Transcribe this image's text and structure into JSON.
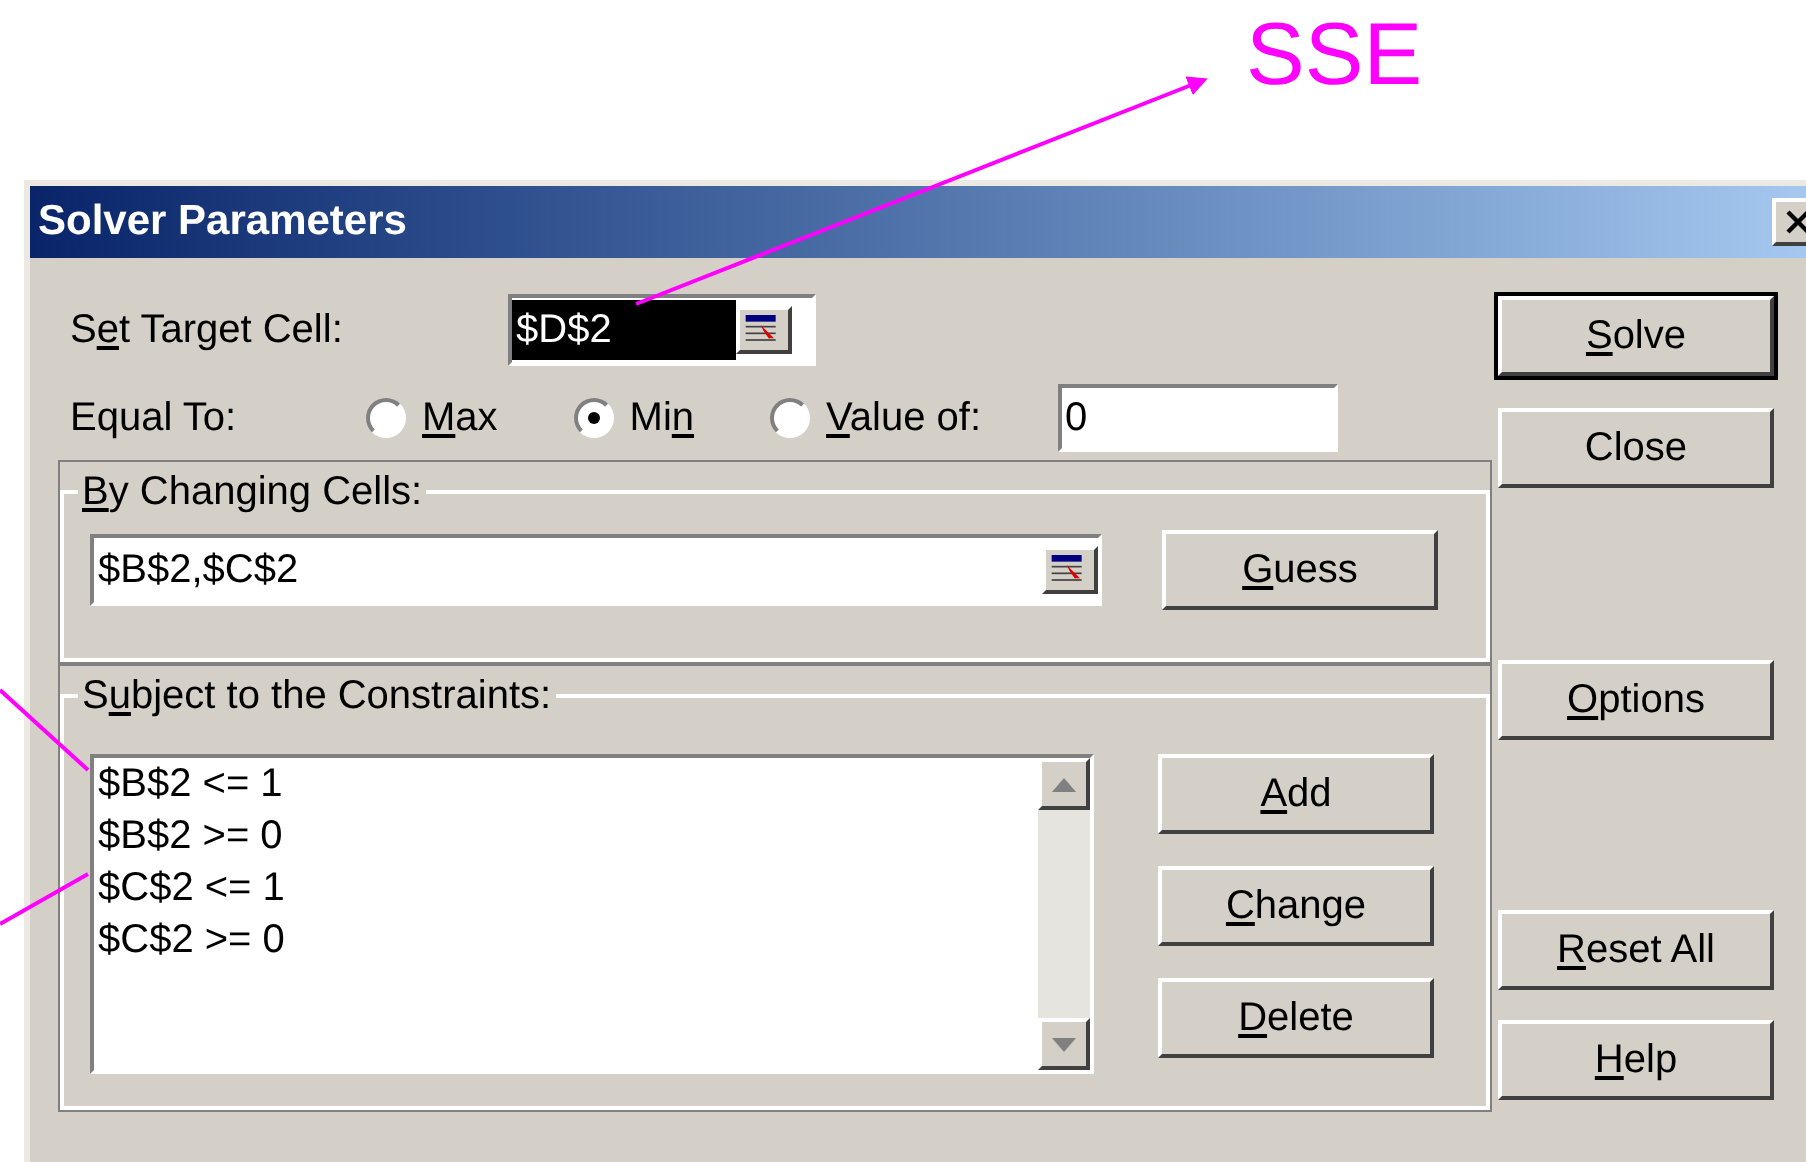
{
  "annotation": {
    "label": "SSE"
  },
  "window": {
    "title": "Solver Parameters"
  },
  "target_cell": {
    "label": {
      "before": "S",
      "key": "e",
      "after": "t Target Cell:"
    },
    "value": "$D$2"
  },
  "equal_to": {
    "label": "Equal To:",
    "value": "0",
    "options": [
      {
        "label": {
          "key": "M",
          "after": "ax"
        },
        "selected": false
      },
      {
        "label": {
          "before": "Mi",
          "key": "n"
        },
        "selected": true
      },
      {
        "label": {
          "key": "V",
          "after": "alue of:"
        },
        "selected": false
      }
    ]
  },
  "changing_cells": {
    "title": {
      "key": "B",
      "after": "y Changing Cells:"
    },
    "value": "$B$2,$C$2",
    "button": {
      "key": "G",
      "after": "uess"
    }
  },
  "constraints": {
    "title": {
      "before": "S",
      "key": "u",
      "after": "bject to the Constraints:"
    },
    "items": [
      "$B$2 <= 1",
      "$B$2 >= 0",
      "$C$2 <= 1",
      "$C$2 >= 0"
    ],
    "buttons": [
      {
        "key": "A",
        "after": "dd"
      },
      {
        "key": "C",
        "after": "hange"
      },
      {
        "key": "D",
        "after": "elete"
      }
    ]
  },
  "side_buttons": [
    {
      "label": {
        "key": "S",
        "after": "olve"
      },
      "default": true
    },
    {
      "label": {
        "after": "Close"
      },
      "default": false
    },
    {
      "label": {
        "key": "O",
        "after": "ptions"
      },
      "default": false
    },
    {
      "label": {
        "key": "R",
        "after": "eset All"
      },
      "default": false
    },
    {
      "label": {
        "key": "H",
        "after": "elp"
      },
      "default": false
    }
  ]
}
